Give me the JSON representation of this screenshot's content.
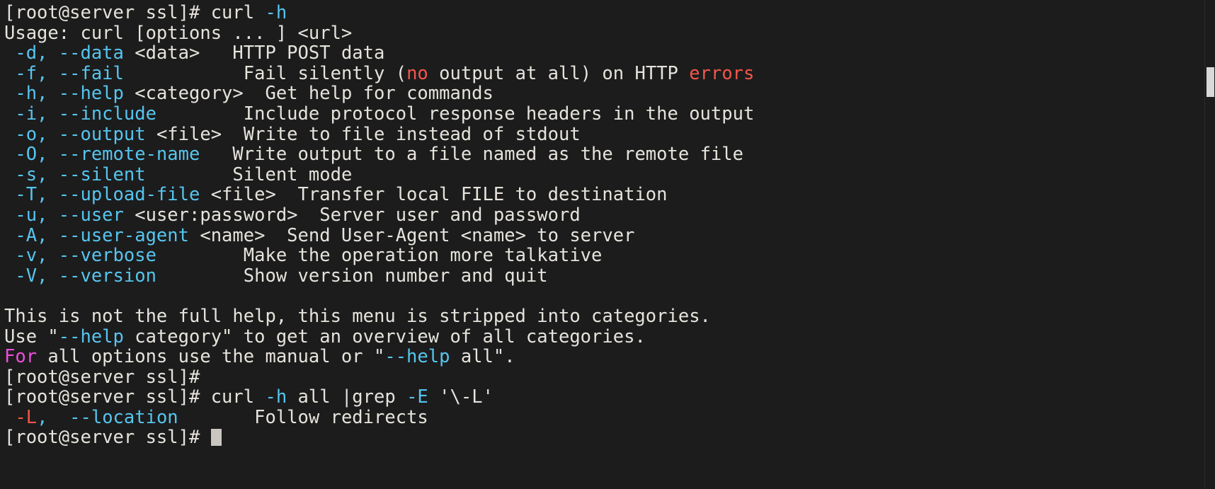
{
  "terminal": {
    "prompt": "[root@server ssl]#",
    "background_color": "#1c1c1c",
    "foreground_color": "#e6e3dd",
    "accent_cyan": "#56c5ef",
    "accent_red": "#f4564a",
    "accent_magenta": "#ef4fdc",
    "cursor_color": "#c9c6c0"
  },
  "lines": {
    "l01_prompt": "[root@server ssl]# ",
    "l01_cmd": "curl ",
    "l01_flag": "-h",
    "l02": "Usage: curl [options ... ] <url>",
    "l03_short": " -d, ",
    "l03_long": "--data",
    "l03_arg": " <data>   ",
    "l03_desc": "HTTP POST data",
    "l04_short": " -f, ",
    "l04_long": "--fail",
    "l04_pad": "           ",
    "l04_desc_a": "Fail silently (",
    "l04_desc_red1": "no",
    "l04_desc_b": " output at all) on HTTP ",
    "l04_desc_red2": "errors",
    "l05_short": " -h, ",
    "l05_long": "--help",
    "l05_arg": " <category>  ",
    "l05_desc": "Get help for commands",
    "l06_short": " -i, ",
    "l06_long": "--include",
    "l06_pad": "        ",
    "l06_desc": "Include protocol response headers in the output",
    "l07_short": " -o, ",
    "l07_long": "--output",
    "l07_arg": " <file>  ",
    "l07_desc": "Write to file instead of stdout",
    "l08_short": " -O, ",
    "l08_long": "--remote-name",
    "l08_pad": "   ",
    "l08_desc": "Write output to a file named as the remote file",
    "l09_short": " -s, ",
    "l09_long": "--silent",
    "l09_pad": "        ",
    "l09_desc": "Silent mode",
    "l10_short": " -T, ",
    "l10_long": "--upload-file",
    "l10_arg": " <file>  ",
    "l10_desc": "Transfer local FILE to destination",
    "l11_short": " -u, ",
    "l11_long": "--user",
    "l11_arg": " <user:password>  ",
    "l11_desc": "Server user and password",
    "l12_short": " -A, ",
    "l12_long": "--user-agent",
    "l12_arg": " <name>  ",
    "l12_desc": "Send User-Agent <name> to server",
    "l13_short": " -v, ",
    "l13_long": "--verbose",
    "l13_pad": "        ",
    "l13_desc": "Make the operation more talkative",
    "l14_short": " -V, ",
    "l14_long": "--version",
    "l14_pad": "        ",
    "l14_desc": "Show version number and quit",
    "l16": "This is not the full help, this menu is stripped into categories.",
    "l17_a": "Use \"",
    "l17_flag": "--help",
    "l17_b": " category\" to get an overview of all categories.",
    "l18_for": "For",
    "l18_a": " all options use the manual or \"",
    "l18_flag": "--help",
    "l18_b": " all\".",
    "l19_prompt": "[root@server ssl]#",
    "l20_prompt": "[root@server ssl]# ",
    "l20_cmd_a": "curl ",
    "l20_flag_h": "-h",
    "l20_cmd_b": " all |grep ",
    "l20_flag_E": "-E",
    "l20_cmd_c": " '\\-L'",
    "l21_short": " ",
    "l21_short_red": "-L",
    "l21_comma": ",  ",
    "l21_long": "--location",
    "l21_pad": "       ",
    "l21_desc": "Follow redirects",
    "l22_prompt": "[root@server ssl]# "
  },
  "scrollbar": {
    "thumb_position_percent": 14,
    "thumb_size_percent": 6
  }
}
